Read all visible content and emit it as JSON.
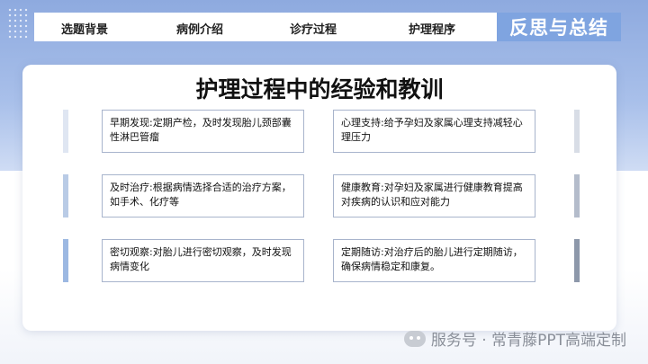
{
  "nav": {
    "tabs": [
      "选题背景",
      "病例介绍",
      "诊疗过程",
      "护理程序"
    ],
    "active": "反思与总结"
  },
  "section_title": "护理过程中的经验和教训",
  "left_items": [
    "早期发现:定期产检，及时发现胎儿颈部囊性淋巴管瘤",
    "及时治疗:根据病情选择合适的治疗方案，如手术、化疗等",
    "密切观察:对胎儿进行密切观察，及时发现病情变化"
  ],
  "right_items": [
    "心理支持:给予孕妇及家属心理支持减轻心理压力",
    "健康教育:对孕妇及家属进行健康教育提高对疾病的认识和应对能力",
    "定期随访:对治疗后的胎儿进行定期随访，确保病情稳定和康复。"
  ],
  "bar_colors": {
    "left": [
      "#dfe6f2",
      "#b9cbe6",
      "#9cb8e2"
    ],
    "right": [
      "#d8dde6",
      "#b4bccb",
      "#8d98aa"
    ]
  },
  "watermark": "服务号 · 常青藤PPT高端定制",
  "watermark_icon": "wechat-icon"
}
